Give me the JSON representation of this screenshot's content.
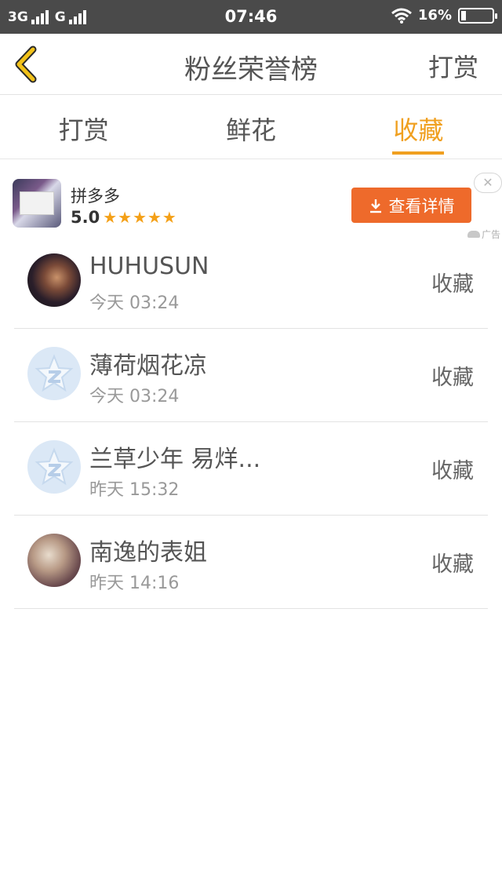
{
  "status_bar": {
    "network1": "3G",
    "network2": "G",
    "time": "07:46",
    "battery": "16%",
    "battery_level": 0.16
  },
  "header": {
    "title": "粉丝荣誉榜",
    "action": "打赏"
  },
  "tabs": [
    {
      "label": "打赏",
      "active": false
    },
    {
      "label": "鲜花",
      "active": false
    },
    {
      "label": "收藏",
      "active": true
    }
  ],
  "ad": {
    "app_name": "拼多多",
    "rating": "5.0",
    "stars": "★★★★★",
    "button_label": "查看详情",
    "close_label": "✕",
    "ad_label": "广告"
  },
  "list": [
    {
      "name": "HUHUSUN",
      "time": "今天 03:24",
      "action": "收藏"
    },
    {
      "name": "薄荷烟花凉",
      "time": "今天 03:24",
      "action": "收藏"
    },
    {
      "name": "兰草少年 易烊...",
      "time": "昨天 15:32",
      "action": "收藏"
    },
    {
      "name": "南逸的表姐",
      "time": "昨天 14:16",
      "action": "收藏"
    }
  ],
  "colors": {
    "accent": "#f0a020",
    "ad_button": "#ee6a2b",
    "status_bar": "#4a4a4a"
  }
}
